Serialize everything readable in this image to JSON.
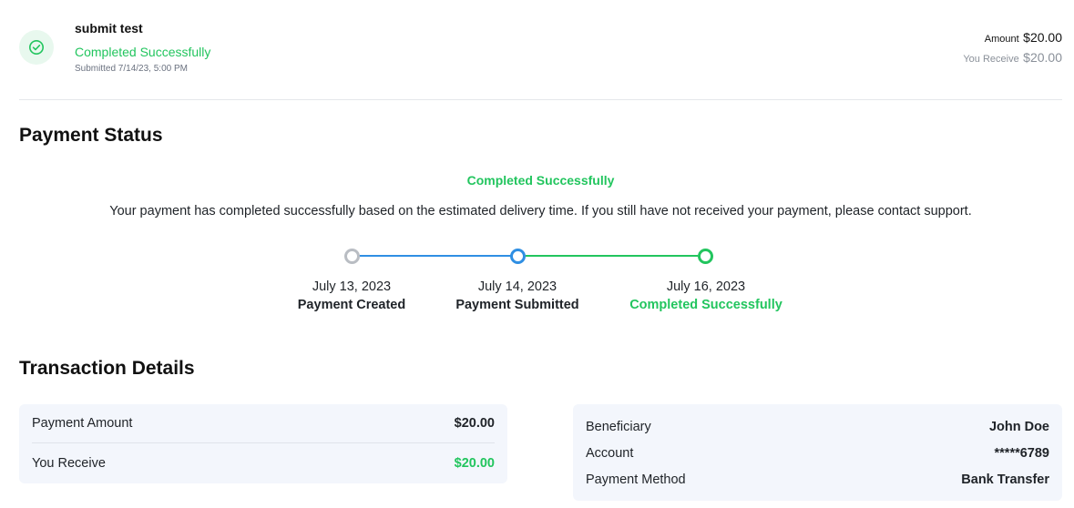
{
  "header": {
    "title": "submit test",
    "status": "Completed Successfully",
    "submitted": "Submitted 7/14/23, 5:00 PM",
    "amount_label": "Amount",
    "amount_value": "$20.00",
    "receive_label": "You Receive",
    "receive_value": "$20.00",
    "status_icon": "check-circle-icon"
  },
  "payment_status": {
    "heading": "Payment Status",
    "status": "Completed Successfully",
    "description": "Your payment has completed successfully based on the estimated delivery time. If you still have not received your payment, please contact support.",
    "timeline": [
      {
        "date": "July 13, 2023",
        "label": "Payment Created"
      },
      {
        "date": "July 14, 2023",
        "label": "Payment Submitted"
      },
      {
        "date": "July 16, 2023",
        "label": "Completed Successfully"
      }
    ]
  },
  "transaction_details": {
    "heading": "Transaction Details",
    "left": [
      {
        "label": "Payment Amount",
        "value": "$20.00"
      },
      {
        "label": "You Receive",
        "value": "$20.00"
      }
    ],
    "right": [
      {
        "label": "Beneficiary",
        "value": "John Doe"
      },
      {
        "label": "Account",
        "value": "*****6789"
      },
      {
        "label": "Payment Method",
        "value": "Bank Transfer"
      }
    ]
  },
  "colors": {
    "success": "#22c55e",
    "progress": "#2f8fe3",
    "pending": "#b9bdc3",
    "card_bg": "#f3f6fc"
  }
}
